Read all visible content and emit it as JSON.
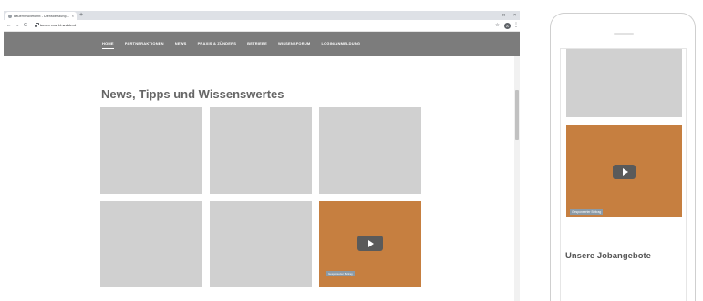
{
  "browser": {
    "tab_title": "Bauernmodmarkt - Dienstleistung...",
    "tab_close": "×",
    "new_tab": "+",
    "window_controls": [
      "–",
      "□",
      "×"
    ],
    "nav_icons": [
      "back-icon",
      "forward-icon",
      "reload-icon"
    ],
    "nav_glyphs": [
      "←",
      "→",
      "C"
    ],
    "url": "bauernmarkt-webb.at",
    "profile_initial": "A",
    "star_glyph": "☆",
    "menu_glyph": "⋮"
  },
  "site": {
    "nav_items": [
      {
        "label": "HOME",
        "active": true
      },
      {
        "label": "PARTNERAKTIONEN",
        "active": false
      },
      {
        "label": "NEWS",
        "active": false
      },
      {
        "label": "PRAXIS & ZÜNDERS",
        "active": false
      },
      {
        "label": "BETRIEBE",
        "active": false
      },
      {
        "label": "WISSENSFORUM",
        "active": false
      },
      {
        "label": "LOGIN/ANMELDUNG",
        "active": false
      }
    ],
    "heading": "News, Tipps und Wissenswertes",
    "cards": [
      {
        "kind": "placeholder"
      },
      {
        "kind": "placeholder"
      },
      {
        "kind": "placeholder"
      },
      {
        "kind": "placeholder"
      },
      {
        "kind": "placeholder"
      },
      {
        "kind": "video",
        "badge": "Gesponserter Beitrag"
      }
    ]
  },
  "mobile": {
    "video_badge": "Gesponserter Beitrag",
    "section_heading": "Unsere Jobangebote"
  },
  "colors": {
    "nav_bg": "#7c7c7c",
    "placeholder": "#d0d0d0",
    "video_bg": "#c67f40",
    "play_button": "#5a5a5a",
    "badge_bg": "#8b9aa6"
  }
}
